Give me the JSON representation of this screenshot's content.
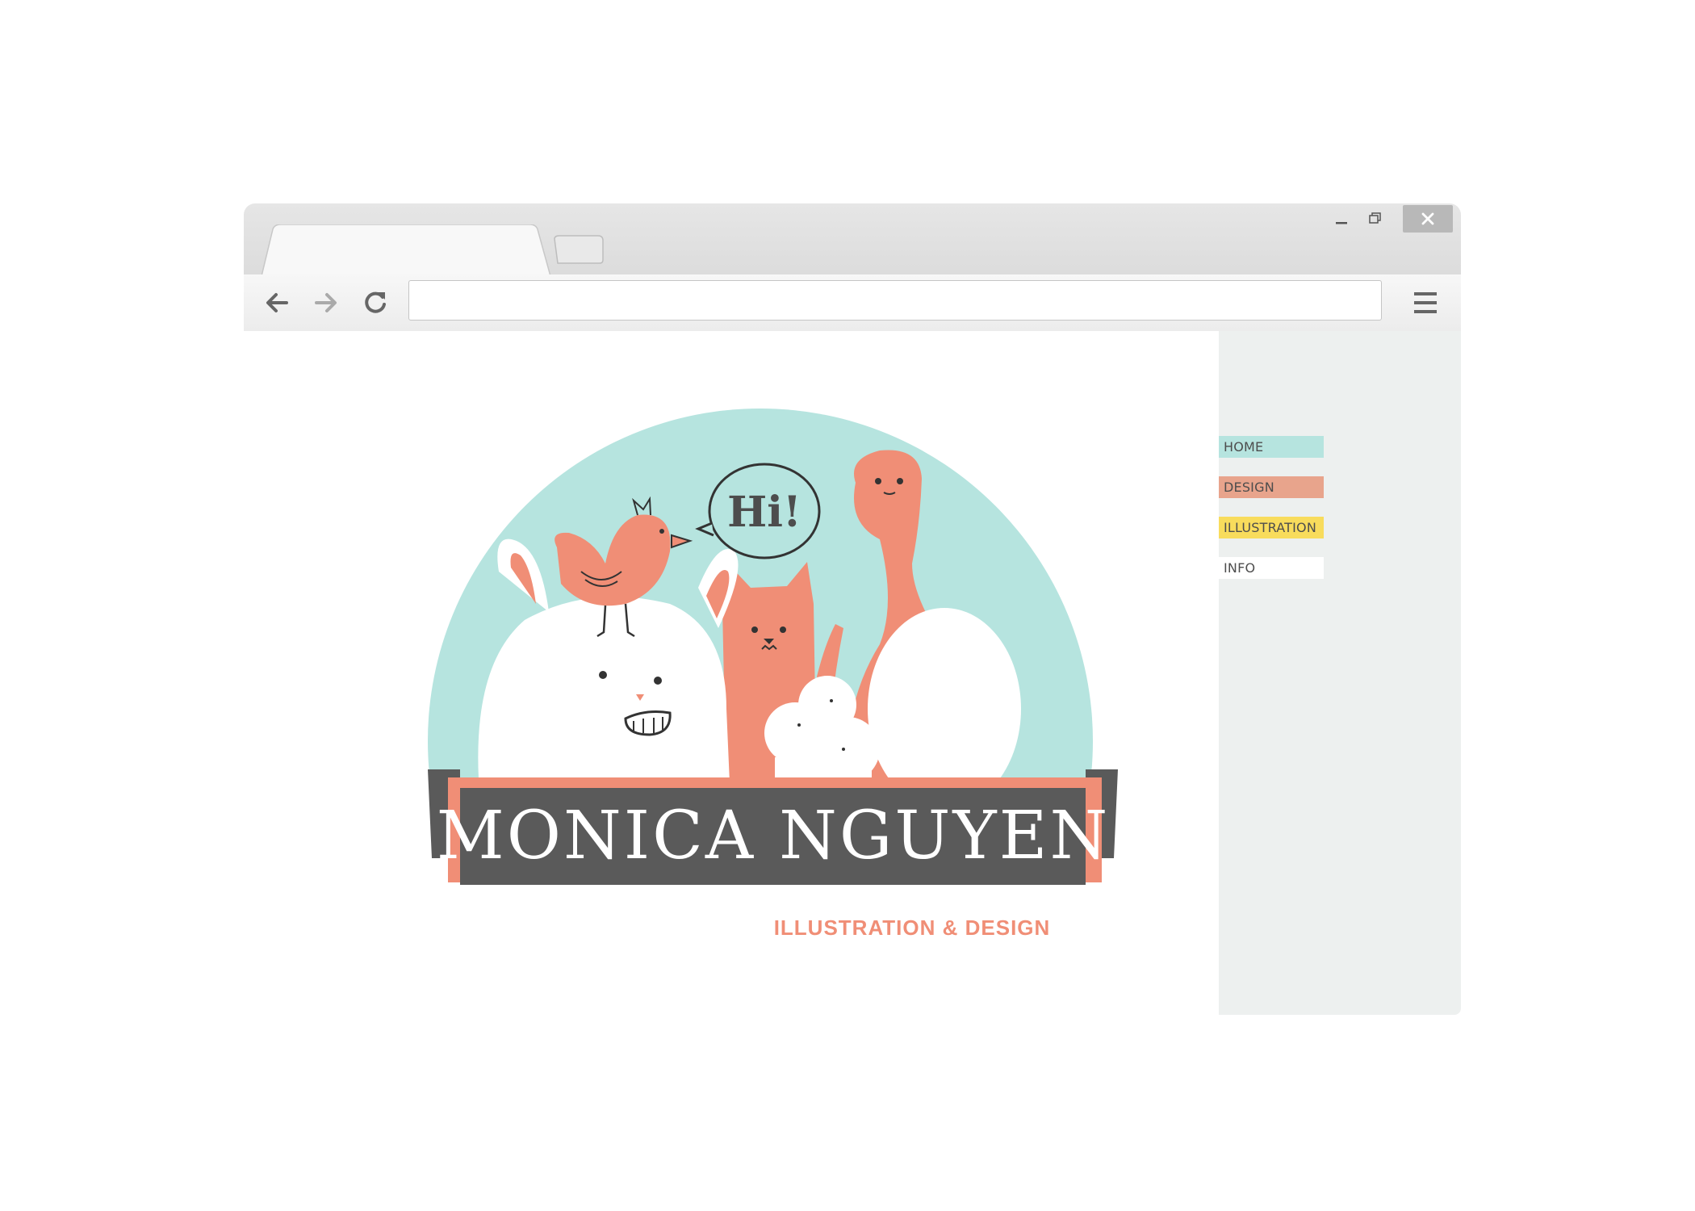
{
  "browser": {
    "address_bar": {
      "value": "",
      "placeholder": ""
    }
  },
  "logo": {
    "name": "MONICA NGUYEN",
    "tagline": "ILLUSTRATION & DESIGN",
    "speech_bubble": "Hi!"
  },
  "nav": {
    "items": [
      {
        "label": "HOME",
        "color": "#b6e4df"
      },
      {
        "label": "DESIGN",
        "color": "#e8a48c"
      },
      {
        "label": "ILLUSTRATION",
        "color": "#f8dc5c"
      },
      {
        "label": "INFO",
        "color": "#ffffff"
      }
    ]
  },
  "colors": {
    "mint": "#b6e4df",
    "coral": "#f08e76",
    "charcoal": "#5a5a5a",
    "sidebar_bg": "#edf0ef"
  }
}
